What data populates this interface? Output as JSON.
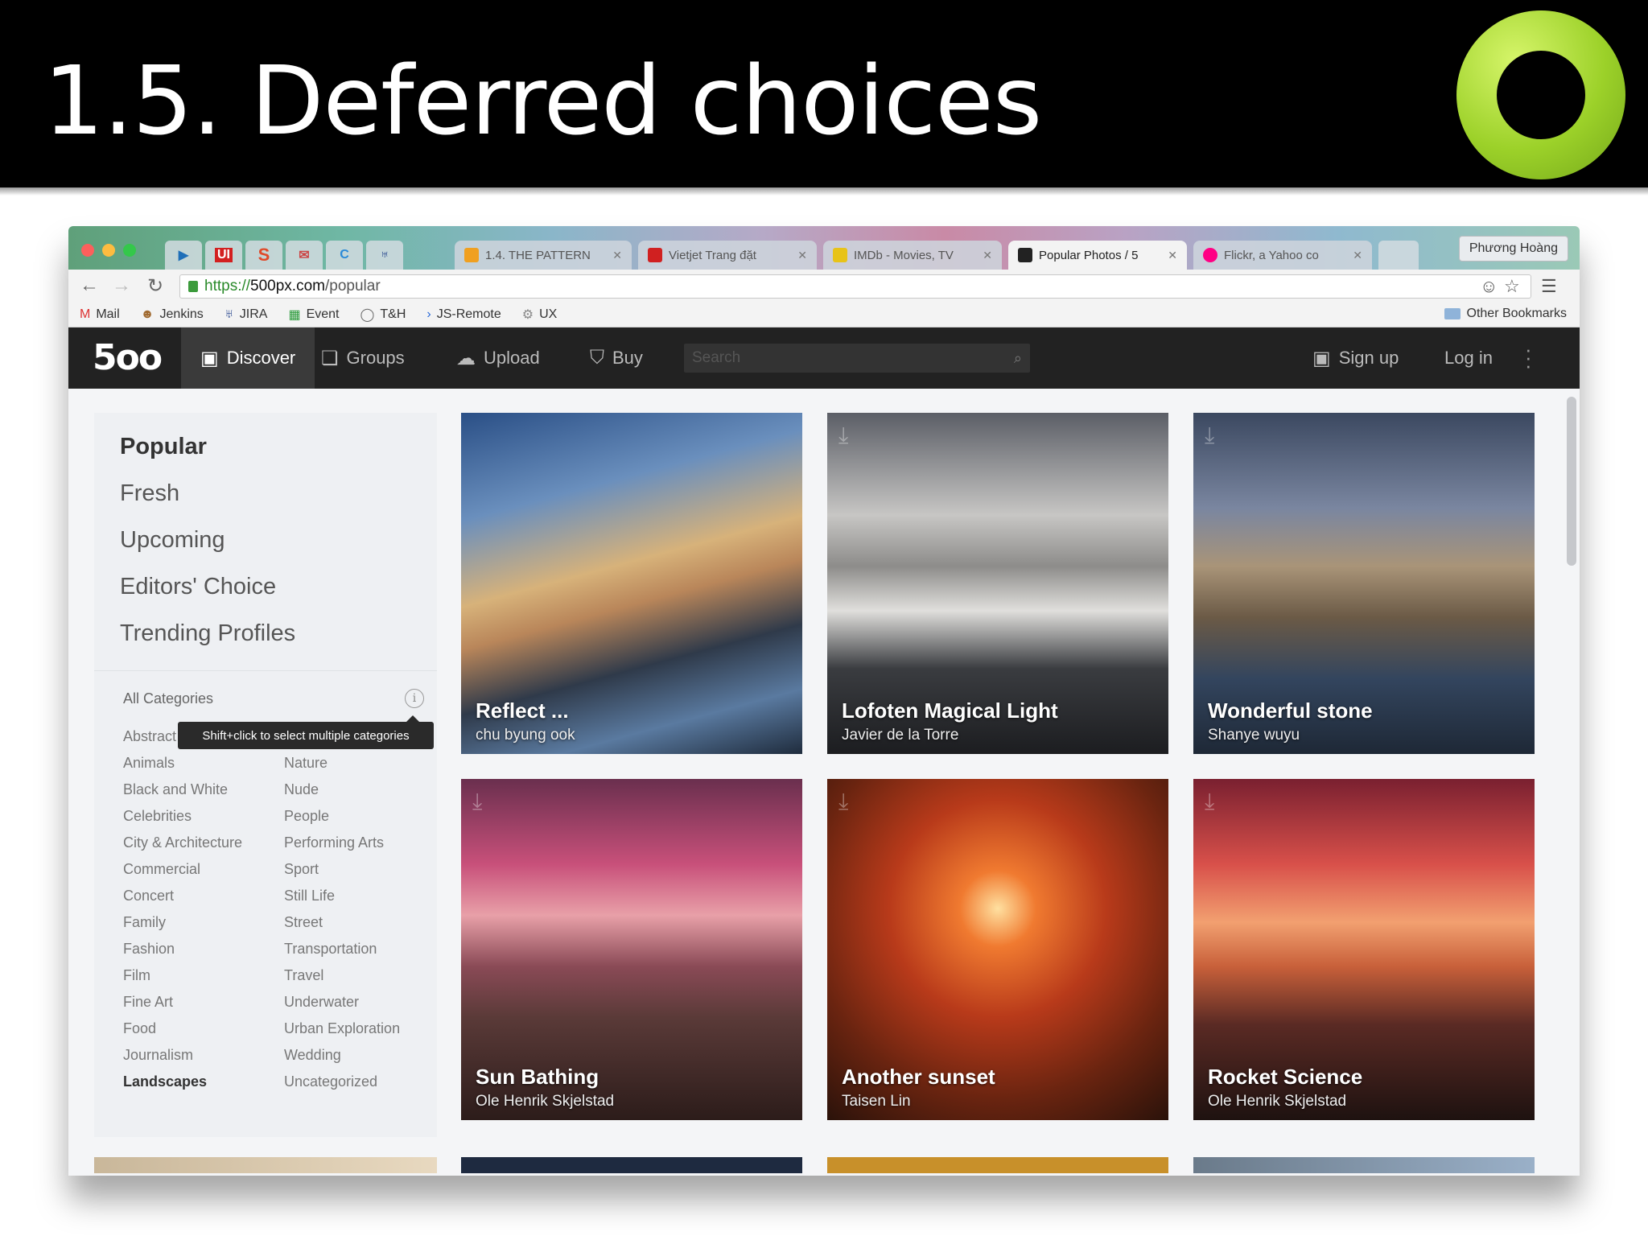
{
  "slide": {
    "title": "1.5. Deferred choices",
    "ring_logo_color": "#9cd129"
  },
  "browser": {
    "pinned_tabs": [
      {
        "icon": "play-icon",
        "label": "▶",
        "color": "#1f6fb8"
      },
      {
        "icon": "ui-icon",
        "label": "UI",
        "color": "#d32020"
      },
      {
        "icon": "s-icon",
        "label": "S",
        "color": "#e04a2a"
      },
      {
        "icon": "mail-icon",
        "label": "✉",
        "color": "#c44"
      },
      {
        "icon": "c-icon",
        "label": "C",
        "color": "#2a8ad8"
      },
      {
        "icon": "jira-icon",
        "label": "♅",
        "color": "#1f3f8a"
      }
    ],
    "tabs": [
      {
        "label": "1.4. THE PATTERN",
        "active": false,
        "icon_color": "#f0a020"
      },
      {
        "label": "Vietjet Trang đặt",
        "active": false,
        "icon_color": "#d02020"
      },
      {
        "label": "IMDb - Movies, TV",
        "active": false,
        "icon_color": "#e8c318"
      },
      {
        "label": "Popular Photos / 5",
        "active": true,
        "icon_color": "#222222"
      },
      {
        "label": "Flickr, a Yahoo co",
        "active": false,
        "icon_color": "#ff0084"
      }
    ],
    "profile_name": "Phương Hoàng",
    "url": {
      "scheme": "https://",
      "domain": "500px.com",
      "path": "/popular"
    },
    "bookmarks": [
      {
        "label": "Mail",
        "icon": "gmail-icon"
      },
      {
        "label": "Jenkins",
        "icon": "jenkins-icon"
      },
      {
        "label": "JIRA",
        "icon": "jira-icon"
      },
      {
        "label": "Event",
        "icon": "calendar-icon"
      },
      {
        "label": "T&H",
        "icon": "globe-icon"
      },
      {
        "label": "JS-Remote",
        "icon": "chevron-right-icon"
      },
      {
        "label": "UX",
        "icon": "gear-icon"
      }
    ],
    "other_bookmarks": "Other Bookmarks"
  },
  "site": {
    "logo": "5oo",
    "nav": [
      {
        "label": "Discover",
        "icon": "image-icon"
      },
      {
        "label": "Groups",
        "icon": "chat-icon"
      },
      {
        "label": "Upload",
        "icon": "upload-cloud-icon"
      },
      {
        "label": "Buy",
        "icon": "shopping-bag-icon"
      }
    ],
    "search_placeholder": "Search",
    "sign_up": "Sign up",
    "log_in": "Log in"
  },
  "sidebar": {
    "links": [
      "Popular",
      "Fresh",
      "Upcoming",
      "Editors' Choice",
      "Trending Profiles"
    ],
    "categories_title": "All Categories",
    "tooltip": "Shift+click to select multiple categories",
    "categories_left": [
      "Abstract",
      "Animals",
      "Black and White",
      "Celebrities",
      "City & Architecture",
      "Commercial",
      "Concert",
      "Family",
      "Fashion",
      "Film",
      "Fine Art",
      "Food",
      "Journalism",
      "Landscapes"
    ],
    "categories_right": [
      "Nature",
      "Nude",
      "People",
      "Performing Arts",
      "Sport",
      "Still Life",
      "Street",
      "Transportation",
      "Travel",
      "Underwater",
      "Urban Exploration",
      "Wedding",
      "Uncategorized"
    ],
    "selected_category": "Landscapes"
  },
  "photos": [
    {
      "title": "Reflect ...",
      "author": "chu byung ook"
    },
    {
      "title": "Lofoten Magical Light",
      "author": "Javier de la Torre"
    },
    {
      "title": "Wonderful stone",
      "author": "Shanye wuyu"
    },
    {
      "title": "Sun Bathing",
      "author": "Ole Henrik Skjelstad"
    },
    {
      "title": "Another sunset",
      "author": "Taisen Lin"
    },
    {
      "title": "Rocket Science",
      "author": "Ole Henrik Skjelstad"
    }
  ]
}
